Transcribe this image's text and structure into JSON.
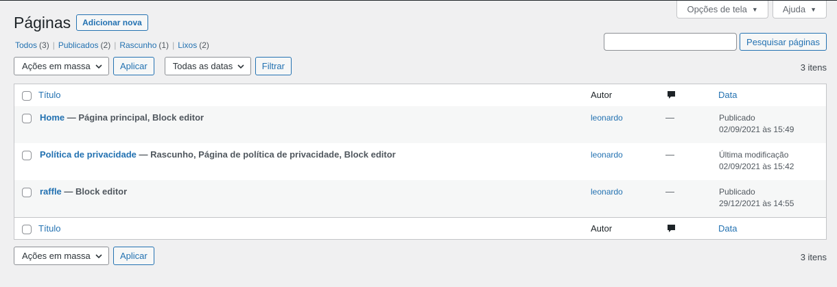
{
  "screen_meta": {
    "screen_options": "Opções de tela",
    "help": "Ajuda"
  },
  "header": {
    "title": "Páginas",
    "add_new": "Adicionar nova"
  },
  "views": [
    {
      "label": "Todos",
      "count": "(3)"
    },
    {
      "label": "Publicados",
      "count": "(2)"
    },
    {
      "label": "Rascunho",
      "count": "(1)"
    },
    {
      "label": "Lixos",
      "count": "(2)"
    }
  ],
  "search": {
    "value": "",
    "button": "Pesquisar páginas"
  },
  "tablenav_top": {
    "bulk_actions": "Ações em massa",
    "apply": "Aplicar",
    "dates": "Todas as datas",
    "filter": "Filtrar",
    "items": "3 itens"
  },
  "table": {
    "columns": {
      "title": "Título",
      "author": "Autor",
      "comments_icon": "comment-icon",
      "date": "Data"
    },
    "rows": [
      {
        "title": "Home",
        "states": " — Página principal, Block editor",
        "author": "leonardo",
        "comments": "—",
        "date_status": "Publicado",
        "date": "02/09/2021 às 15:49"
      },
      {
        "title": "Política de privacidade",
        "states": " — Rascunho, Página de política de privacidade, Block editor",
        "author": "leonardo",
        "comments": "—",
        "date_status": "Última modificação",
        "date": "02/09/2021 às 15:42"
      },
      {
        "title": "raffle",
        "states": " — Block editor",
        "author": "leonardo",
        "comments": "—",
        "date_status": "Publicado",
        "date": "29/12/2021 às 14:55"
      }
    ]
  },
  "tablenav_bottom": {
    "bulk_actions": "Ações em massa",
    "apply": "Aplicar",
    "items": "3 itens"
  },
  "colors": {
    "link": "#2271b1",
    "background": "#f0f0f1",
    "border": "#c3c4c7"
  }
}
